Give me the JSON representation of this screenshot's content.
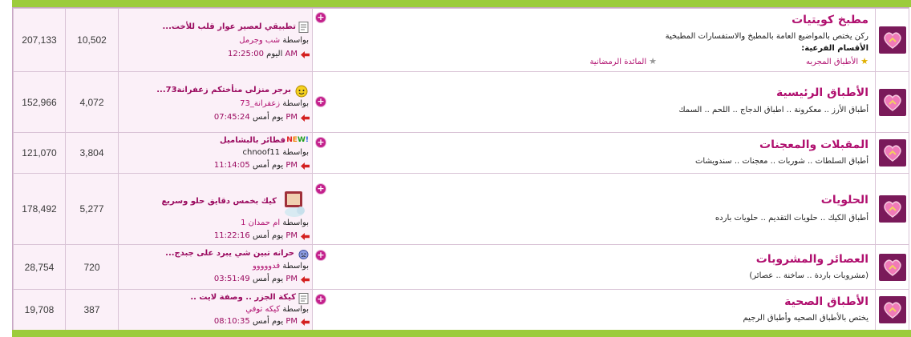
{
  "colors": {
    "accent": "#b0106f",
    "bar": "#9ccc3c",
    "stats_bg": "#fbf0f8",
    "border": "#d9c3d6"
  },
  "forums": [
    {
      "title": "مطبخ كويتيات",
      "description": "ركن يختص بالمواضيع العامة بالمطبخ والاستفسارات المطبخية",
      "subforums_label": "الأقسام الفرعية:",
      "subforums": [
        "الأطباق المجربه",
        "المائدة الرمضانية"
      ],
      "threads": "10,502",
      "posts": "207,133",
      "last_post": {
        "title": "تطبيقي لعصير عوار قلب للأخت...",
        "by_prefix": "بواسطة",
        "user": "شب وجرمل",
        "day": "اليوم",
        "time": "12:25:00 AM",
        "icon": "document-icon"
      }
    },
    {
      "title": "الأطباق الرئيسية",
      "description": "أطباق الأرز .. معكرونة .. اطباق الدجاج .. اللحم .. السمك",
      "threads": "4,072",
      "posts": "152,966",
      "last_post": {
        "title": "برجر منزلى منأختكم زعفرانة73...",
        "by_prefix": "بواسطة",
        "user": "زعفرانة_73",
        "day": "يوم أمس",
        "time": "07:45:24 PM",
        "icon": "smiley-icon"
      }
    },
    {
      "title": "المقبلات والمعجنات",
      "description": "أطباق السلطات .. شوربات .. معجنات .. سندويشات",
      "threads": "3,804",
      "posts": "121,070",
      "last_post": {
        "title": "فطائر بالبشاميل",
        "badge": "NEW!",
        "by_prefix": "بواسطة",
        "user": "chnoof11",
        "day": "يوم أمس",
        "time": "11:14:05 PM",
        "icon": "new-badge-icon"
      }
    },
    {
      "title": "الحلويات",
      "description": "أطباق الكيك .. حلويات التقديم .. حلويات بارده",
      "threads": "5,277",
      "posts": "178,492",
      "last_post": {
        "title": "كيك بخمس دقايق حلو وسريع",
        "by_prefix": "بواسطة",
        "user": "ام حمدان 1",
        "day": "يوم أمس",
        "time": "11:22:16 PM",
        "icon": "reading-character-icon"
      }
    },
    {
      "title": "العصائر والمشروبات",
      "description": "(مشروبات باردة .. ساخنة .. عصائر)",
      "threads": "720",
      "posts": "28,754",
      "last_post": {
        "title": "حرانه تبين شي يبرد على جبدج...",
        "by_prefix": "بواسطة",
        "user": "فدووووو",
        "day": "يوم أمس",
        "time": "03:51:49 PM",
        "icon": "sad-face-icon"
      }
    },
    {
      "title": "الأطباق الصحية",
      "description": "يختص بالأطباق الصحيه وأطباق الرجيم",
      "threads": "387",
      "posts": "19,708",
      "last_post": {
        "title": "كيكة الجزر .. وصفة لايت ..",
        "by_prefix": "بواسطة",
        "user": "كيكه توفي",
        "day": "يوم أمس",
        "time": "08:10:35 PM",
        "icon": "document-icon"
      }
    }
  ]
}
